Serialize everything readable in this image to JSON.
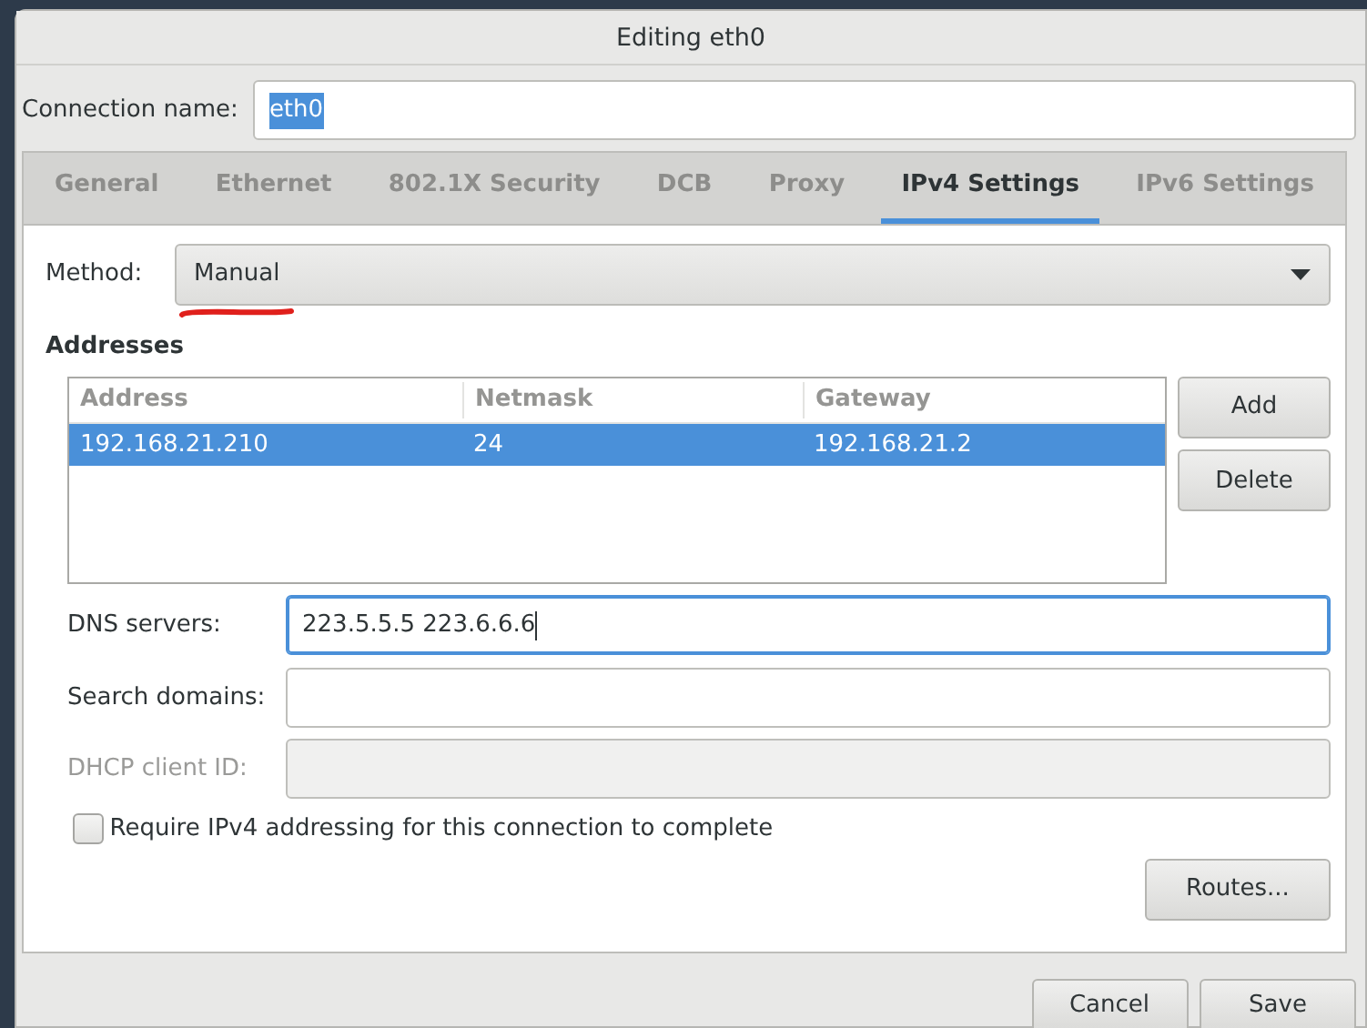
{
  "window": {
    "title": "Editing eth0"
  },
  "connection_name": {
    "label": "Connection name:",
    "value": "eth0",
    "text_selected": true
  },
  "tabs": [
    {
      "label": "General",
      "selected": false
    },
    {
      "label": "Ethernet",
      "selected": false
    },
    {
      "label": "802.1X Security",
      "selected": false
    },
    {
      "label": "DCB",
      "selected": false
    },
    {
      "label": "Proxy",
      "selected": false
    },
    {
      "label": "IPv4 Settings",
      "selected": true
    },
    {
      "label": "IPv6 Settings",
      "selected": false
    }
  ],
  "method": {
    "label": "Method:",
    "value": "Manual",
    "underlined": true
  },
  "addresses": {
    "heading": "Addresses",
    "columns": [
      "Address",
      "Netmask",
      "Gateway"
    ],
    "rows": [
      {
        "cells": [
          "192.168.21.210",
          "24",
          "192.168.21.2"
        ],
        "selected": true
      }
    ],
    "buttons": [
      "Add",
      "Delete"
    ]
  },
  "fields": [
    {
      "label": "DNS servers:",
      "value": "223.5.5.5 223.6.6.6",
      "focused": true,
      "disabled": false
    },
    {
      "label": "Search domains:",
      "focused": false,
      "disabled": false
    },
    {
      "label": "DHCP client ID:",
      "focused": false,
      "disabled": true
    }
  ],
  "require_checkbox": {
    "label": "Require IPv4 addressing for this connection to complete",
    "checked": false
  },
  "routes_button": "Routes...",
  "footer_buttons": [
    "Cancel",
    "Save"
  ]
}
